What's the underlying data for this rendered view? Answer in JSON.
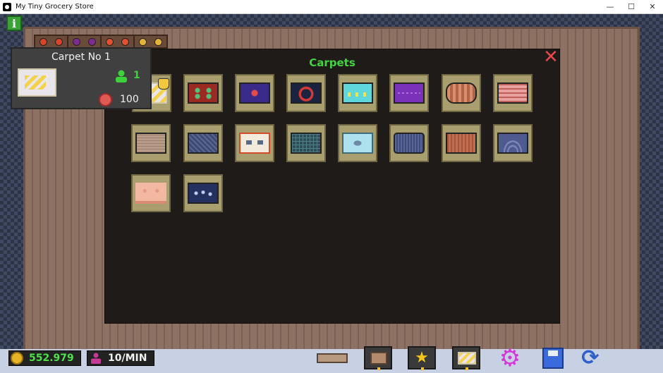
{
  "window": {
    "title": "My Tiny Grocery Store",
    "minimize": "—",
    "maximize": "☐",
    "close": "✕"
  },
  "info_button": {
    "label": "i"
  },
  "tooltip": {
    "title": "Carpet No 1",
    "customers": "1",
    "price": "100"
  },
  "panel": {
    "title": "Carpets",
    "close_symbol": "✕"
  },
  "carpets": [
    {
      "name": "carpet-1"
    },
    {
      "name": "carpet-2"
    },
    {
      "name": "carpet-3"
    },
    {
      "name": "carpet-4"
    },
    {
      "name": "carpet-5"
    },
    {
      "name": "carpet-6"
    },
    {
      "name": "carpet-7"
    },
    {
      "name": "carpet-8"
    },
    {
      "name": "carpet-9"
    },
    {
      "name": "carpet-10"
    },
    {
      "name": "carpet-11"
    },
    {
      "name": "carpet-12"
    },
    {
      "name": "carpet-13"
    },
    {
      "name": "carpet-14"
    },
    {
      "name": "carpet-15"
    },
    {
      "name": "carpet-16"
    },
    {
      "name": "carpet-17"
    },
    {
      "name": "carpet-18"
    }
  ],
  "hud": {
    "money": "552.979",
    "rate": "10/MIN"
  },
  "toolbar": {
    "star_symbol": "★",
    "settings_symbol": "⚙",
    "refresh_symbol": "⟳"
  },
  "colors": {
    "accent_green": "#44d240",
    "close_red": "#e8484c",
    "money_green": "#4ee04a"
  }
}
